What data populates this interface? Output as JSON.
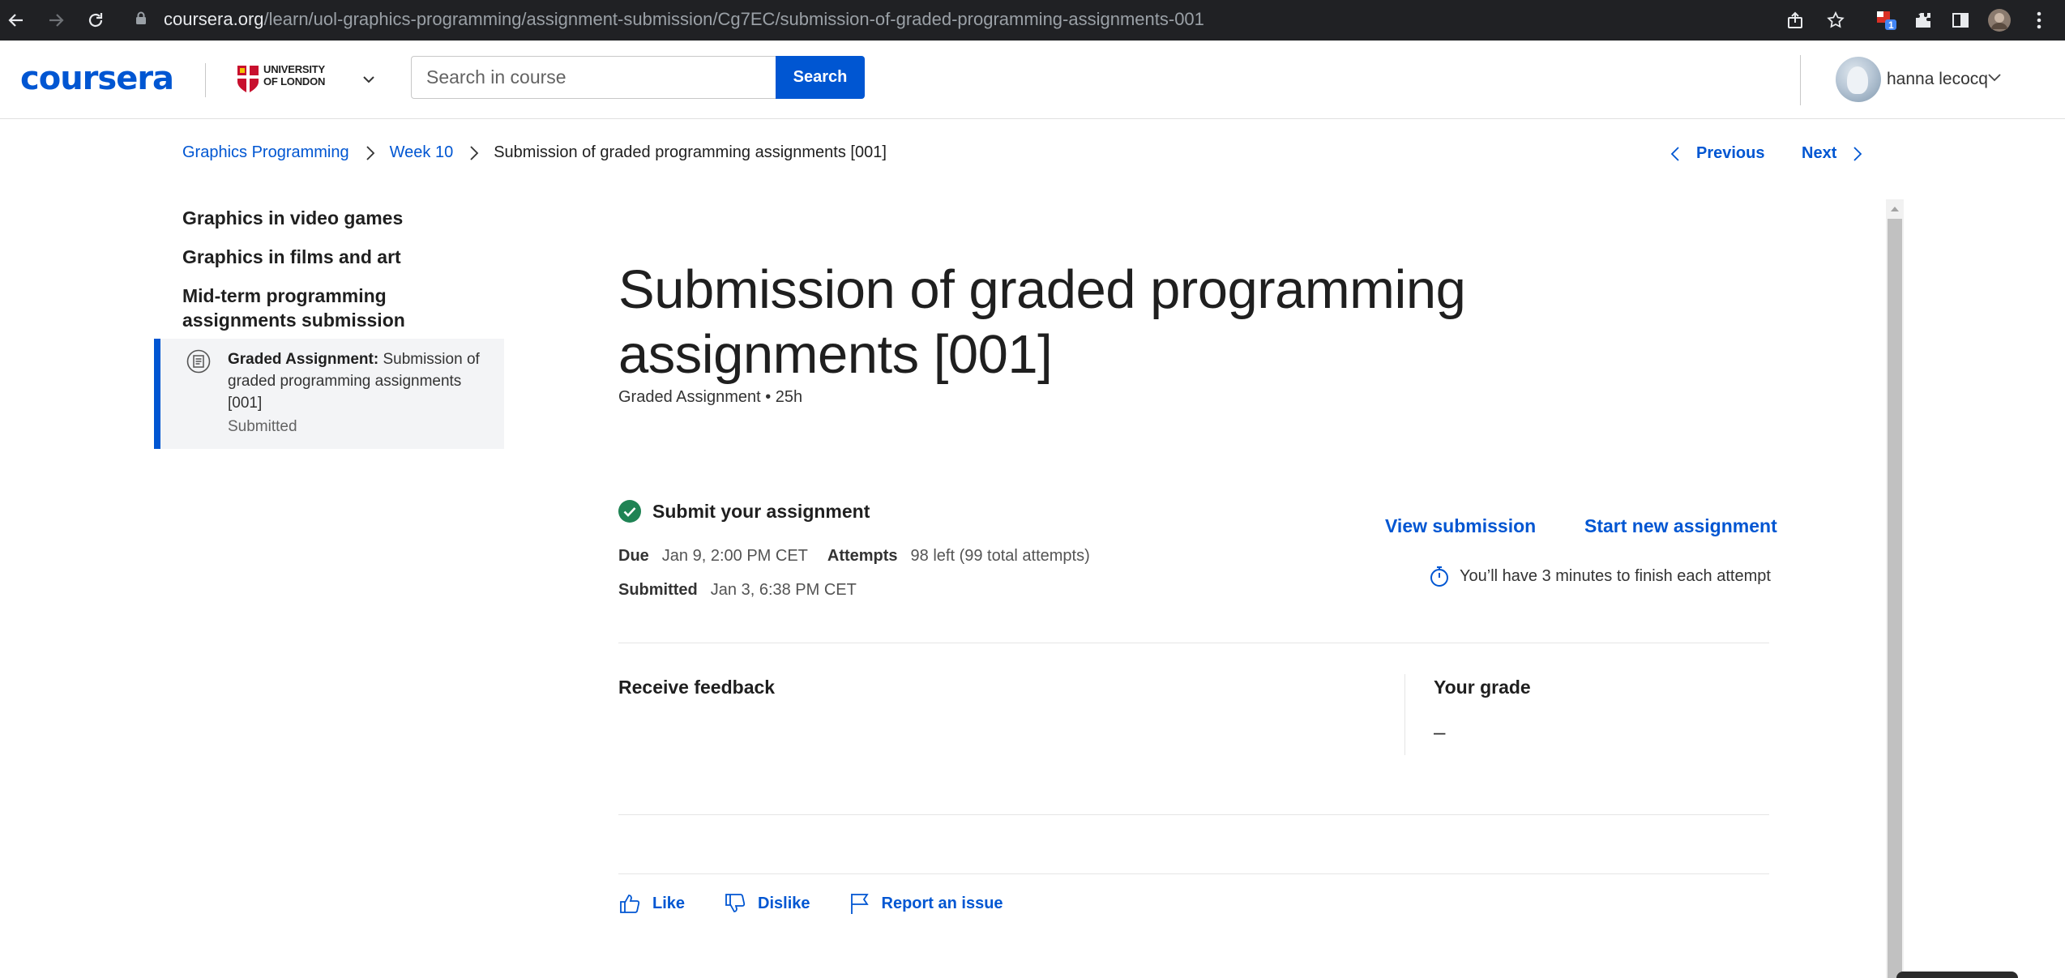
{
  "browser": {
    "url_host": "coursera.org",
    "url_path": "/learn/uol-graphics-programming/assignment-submission/Cg7EC/submission-of-graded-programming-assignments-001",
    "extension_badge": "1"
  },
  "header": {
    "logo": "coursera",
    "university_line1": "UNIVERSITY",
    "university_line2": "OF LONDON",
    "search_placeholder": "Search in course",
    "search_button": "Search",
    "user_name": "hanna lecocq"
  },
  "breadcrumb": {
    "course": "Graphics Programming",
    "week": "Week 10",
    "current": "Submission of graded programming assignments [001]"
  },
  "nav": {
    "previous": "Previous",
    "next": "Next"
  },
  "sidebar": {
    "headings": [
      "Graphics in video games",
      "Graphics in films and art",
      "Mid-term programming assignments submission"
    ],
    "active_item": {
      "type_label": "Graded Assignment:",
      "title": "Submission of graded programming assignments [001]",
      "status": "Submitted"
    }
  },
  "main": {
    "title": "Submission of graded programming assignments [001]",
    "meta": "Graded Assignment • 25h",
    "submit_heading": "Submit your assignment",
    "due_label": "Due",
    "due_value": "Jan 9, 2:00 PM CET",
    "attempts_label": "Attempts",
    "attempts_value": "98 left (99 total attempts)",
    "submitted_label": "Submitted",
    "submitted_value": "Jan 3, 6:38 PM CET",
    "view_submission": "View submission",
    "start_new": "Start new assignment",
    "timer_note": "You’ll have 3 minutes to finish each attempt",
    "receive_feedback": "Receive feedback",
    "your_grade": "Your grade",
    "grade_value": "–"
  },
  "feedback": {
    "like": "Like",
    "dislike": "Dislike",
    "report": "Report an issue"
  },
  "colors": {
    "accent": "#0056d2",
    "success": "#1f8354",
    "chrome": "#202124"
  }
}
